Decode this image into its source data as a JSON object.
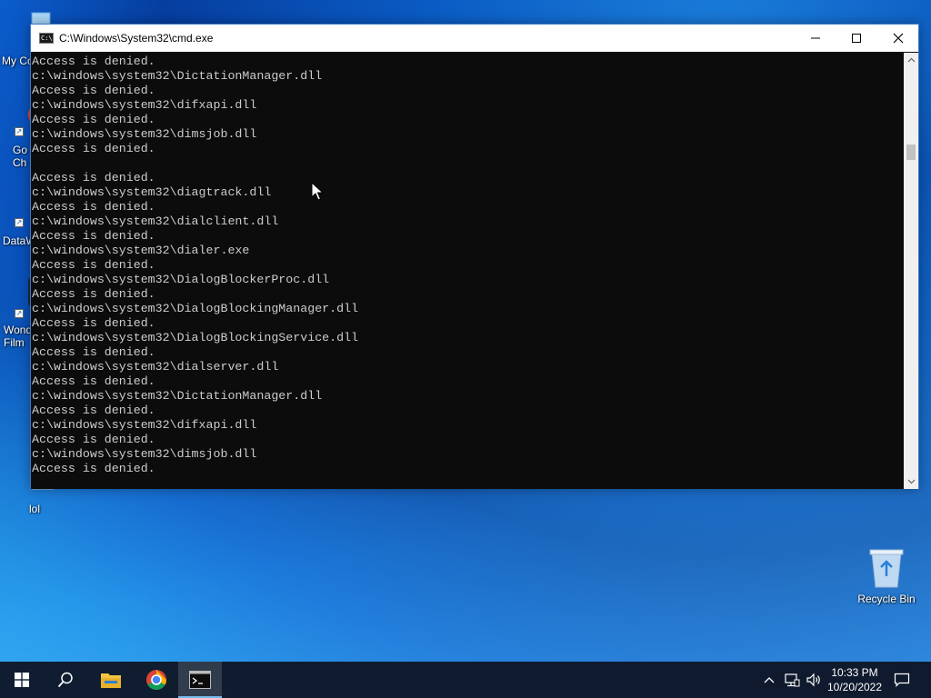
{
  "window": {
    "title": "C:\\Windows\\System32\\cmd.exe",
    "icon": "console-icon",
    "minimize_icon": "minimize-icon",
    "maximize_icon": "maximize-icon",
    "close_icon": "close-icon"
  },
  "console": {
    "lines": [
      "Access is denied.",
      "c:\\windows\\system32\\DictationManager.dll",
      "Access is denied.",
      "c:\\windows\\system32\\difxapi.dll",
      "Access is denied.",
      "c:\\windows\\system32\\dimsjob.dll",
      "Access is denied.",
      "",
      "Access is denied.",
      "c:\\windows\\system32\\diagtrack.dll",
      "Access is denied.",
      "c:\\windows\\system32\\dialclient.dll",
      "Access is denied.",
      "c:\\windows\\system32\\dialer.exe",
      "Access is denied.",
      "c:\\windows\\system32\\DialogBlockerProc.dll",
      "Access is denied.",
      "c:\\windows\\system32\\DialogBlockingManager.dll",
      "Access is denied.",
      "c:\\windows\\system32\\DialogBlockingService.dll",
      "Access is denied.",
      "c:\\windows\\system32\\dialserver.dll",
      "Access is denied.",
      "c:\\windows\\system32\\DictationManager.dll",
      "Access is denied.",
      "c:\\windows\\system32\\difxapi.dll",
      "Access is denied.",
      "c:\\windows\\system32\\dimsjob.dll",
      "Access is denied."
    ]
  },
  "desktop": {
    "icons": [
      {
        "label": "My Co",
        "icon": "computer-icon"
      },
      {
        "label": "Go\nCh",
        "icon": "chrome-icon"
      },
      {
        "label": "DataW",
        "icon": "database-icon"
      },
      {
        "label": "Wond\nFilm",
        "icon": "video-editor-icon"
      },
      {
        "label": "",
        "icon": "document-icon"
      },
      {
        "label": "lol",
        "icon": "text-file-icon"
      },
      {
        "label": "Recycle Bin",
        "icon": "recycle-bin-icon"
      }
    ]
  },
  "taskbar": {
    "start_icon": "windows-start-icon",
    "search_icon": "search-icon",
    "pinned": [
      {
        "name": "File Explorer",
        "icon": "folder-icon"
      },
      {
        "name": "Google Chrome",
        "icon": "chrome-icon"
      },
      {
        "name": "Command Prompt",
        "icon": "console-icon",
        "active": true
      }
    ],
    "tray": {
      "overflow_icon": "chevron-up-icon",
      "network_icon": "network-icon",
      "volume_icon": "volume-icon",
      "notification_icon": "notification-icon"
    },
    "clock": {
      "time": "10:33 PM",
      "date": "10/20/2022"
    }
  },
  "colors": {
    "console_bg": "#0c0c0c",
    "console_fg": "#cccccc",
    "taskbar_bg": "#101828",
    "accent": "#76b9ed"
  }
}
